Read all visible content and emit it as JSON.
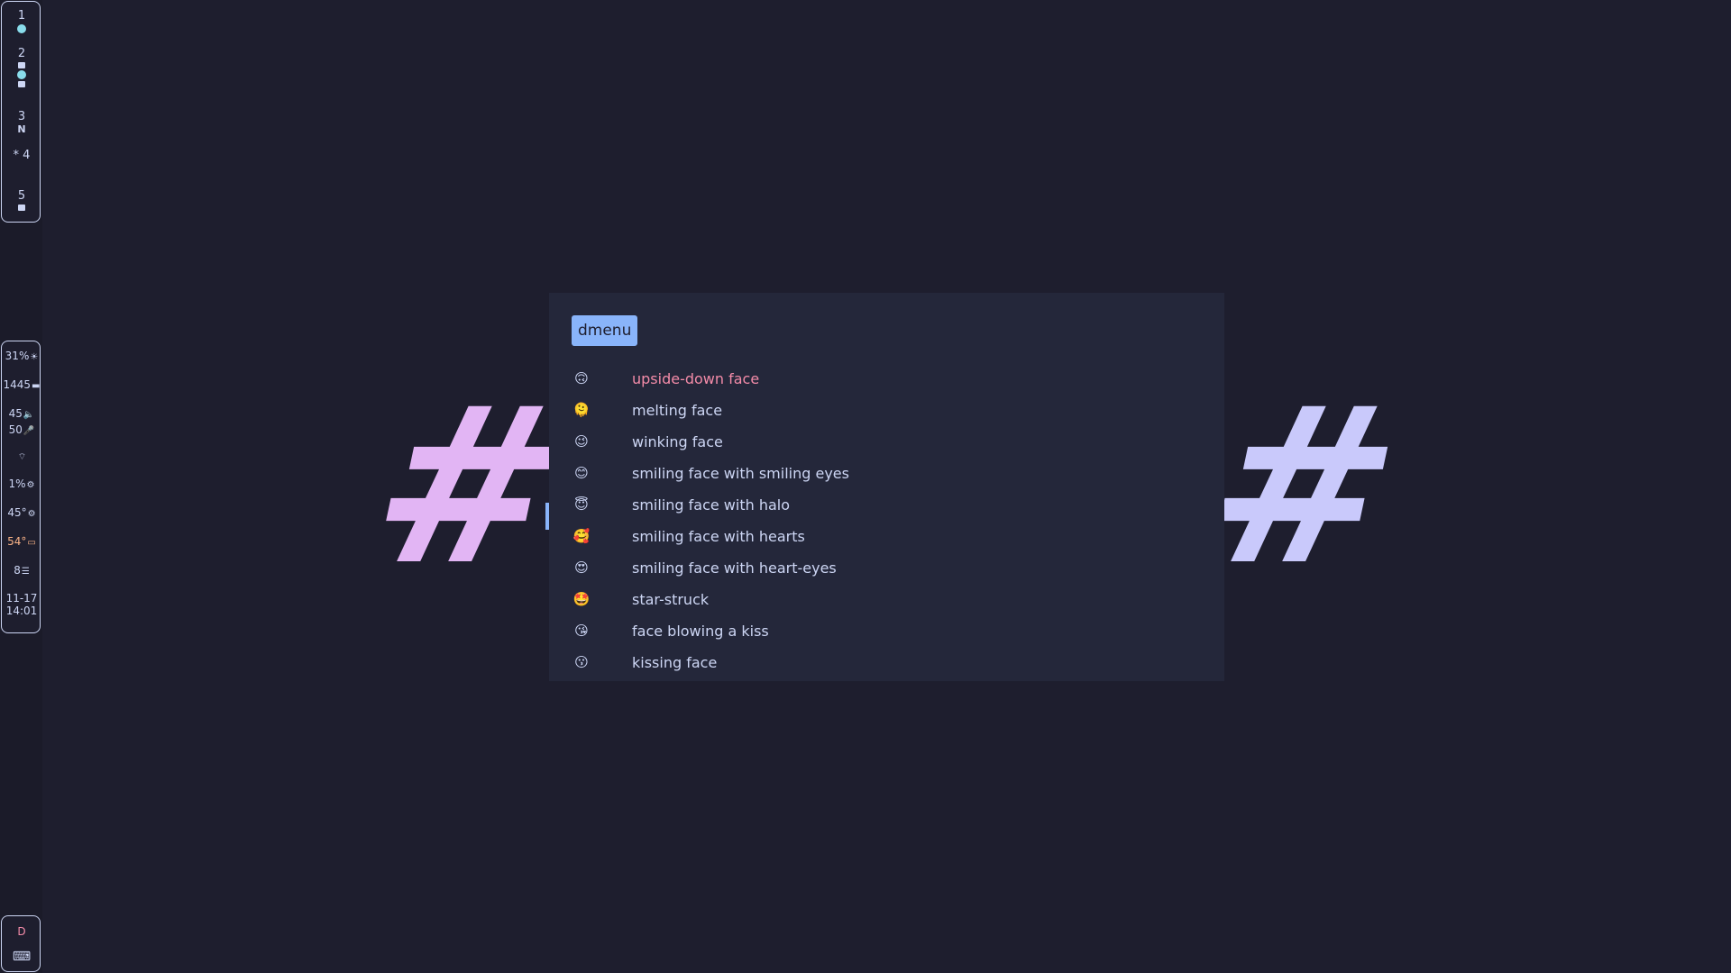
{
  "workspaces": [
    {
      "num": "1",
      "icons": [
        "dot"
      ]
    },
    {
      "num": "2",
      "icons": [
        "sq",
        "dot",
        "sq"
      ]
    },
    {
      "num": "3",
      "icons": [
        "N"
      ]
    },
    {
      "num": "* 4",
      "icons": []
    },
    {
      "num": "5",
      "icons": [
        "sq"
      ]
    }
  ],
  "stats": {
    "brightness": "31%",
    "brightness_icon": "☀",
    "disk": "1445",
    "disk_icon": "▬",
    "volume": "45",
    "volume_icon": "🔈",
    "mic": "50",
    "mic_icon": "🎤",
    "wifi_icon": "⌔",
    "cpu": "1%",
    "cpu_icon": "⚙",
    "temp": "45°",
    "temp_icon": "⚙",
    "gpu_temp": "54°",
    "gpu_icon": "▭",
    "notifications": "8",
    "notif_icon": "☰",
    "date": "11-17",
    "time": "14:01"
  },
  "bottom": {
    "layout": "D",
    "keyboard_icon": "⌨"
  },
  "colors": {
    "accent": "#89b4fa",
    "selected_text": "#f38ba8",
    "warn": "#fab387"
  },
  "menu": {
    "prompt": "dmenu",
    "items": [
      {
        "emoji": "🙃",
        "label": "upside-down face"
      },
      {
        "emoji": "🫠",
        "label": "melting face"
      },
      {
        "emoji": "😉",
        "label": "winking face"
      },
      {
        "emoji": "😊",
        "label": "smiling face with smiling eyes"
      },
      {
        "emoji": "😇",
        "label": "smiling face with halo"
      },
      {
        "emoji": "🥰",
        "label": "smiling face with hearts"
      },
      {
        "emoji": "😍",
        "label": "smiling face with heart-eyes"
      },
      {
        "emoji": "🤩",
        "label": "star-struck"
      },
      {
        "emoji": "😘",
        "label": "face blowing a kiss"
      },
      {
        "emoji": "😗",
        "label": "kissing face"
      }
    ]
  },
  "wallpaper": {
    "glyph": "#"
  }
}
